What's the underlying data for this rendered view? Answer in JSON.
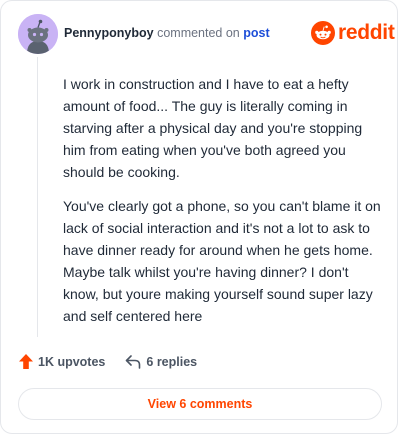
{
  "comment": {
    "author": "Pennyponyboy",
    "action_text": "commented on",
    "target_link": "post",
    "paragraphs": [
      "I work in construction and I have to eat a hefty amount of food... The guy is literally coming in starving after a physical day and you're stopping him from eating when you've both agreed you should be cooking.",
      "You've clearly got a phone, so you can't blame it on lack of social interaction and it's not a lot to ask to have dinner ready for around when he gets home. Maybe talk whilst you're having dinner? I don't know, but youre making yourself sound super lazy and self centered here"
    ]
  },
  "brand": {
    "name": "reddit",
    "color": "#ff4500"
  },
  "actions": {
    "upvotes_label": "1K upvotes",
    "replies_label": "6 replies"
  },
  "footer": {
    "view_comments_label": "View 6 comments"
  },
  "icons": {
    "avatar": "snoo-avatar",
    "logo": "reddit-logo-icon",
    "upvote": "upvote-arrow-icon",
    "reply": "reply-arrow-icon"
  }
}
